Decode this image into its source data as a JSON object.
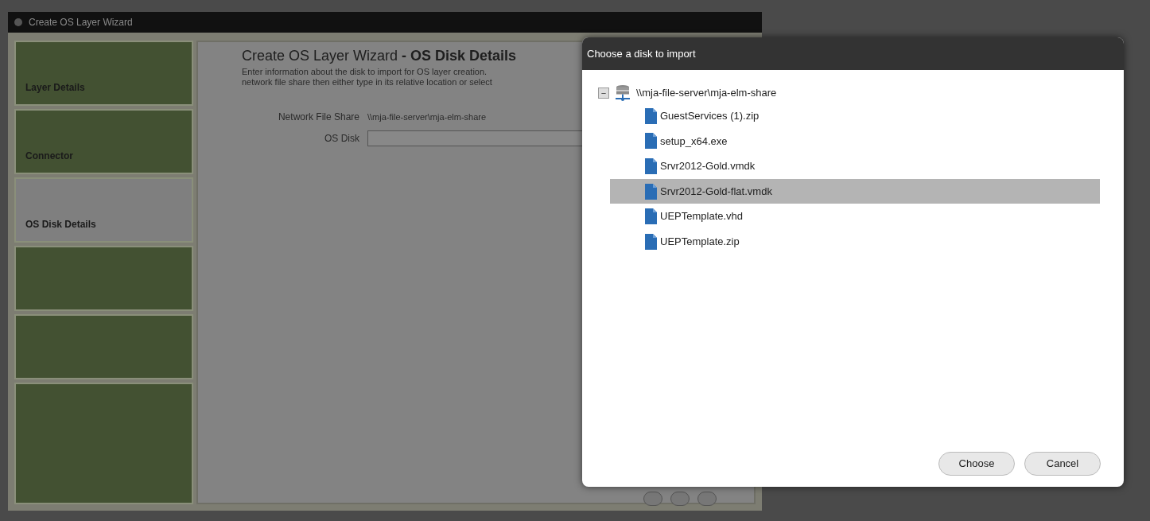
{
  "wizard": {
    "title": "Create OS Layer Wizard",
    "steps": [
      {
        "label": "Layer Details",
        "selected": false
      },
      {
        "label": "Connector",
        "selected": false
      },
      {
        "label": "OS Disk Details",
        "selected": true
      },
      {
        "selected": false
      },
      {
        "selected": false
      },
      {
        "selected": false
      }
    ],
    "heading": "Create OS Layer Wizard **- OS Disk Details**",
    "description": [
      "Enter information about the disk to import for OS layer creation.",
      "network file share then either type in its relative location or select"
    ],
    "fields": [
      {
        "label": "Network File Share",
        "kind": "text",
        "value": "\\\\mja-file-server\\mja-elm-share"
      },
      {
        "label": "OS Disk",
        "kind": "input"
      }
    ]
  },
  "dialog": {
    "title": "Choose a disk to import",
    "tree": {
      "label": "\\\\mja-file-server\\mja-elm-share",
      "expanded": true,
      "expander": "−",
      "children": [
        {
          "label": "GuestServices (1).zip",
          "selected": false
        },
        {
          "label": "setup_x64.exe",
          "selected": false
        },
        {
          "label": "Srvr2012-Gold.vmdk",
          "selected": false
        },
        {
          "label": "Srvr2012-Gold-flat.vmdk",
          "selected": true
        },
        {
          "label": "UEPTemplate.vhd",
          "selected": false
        },
        {
          "label": "UEPTemplate.zip",
          "selected": false
        }
      ]
    },
    "buttons": [
      "Choose",
      "Cancel"
    ]
  }
}
